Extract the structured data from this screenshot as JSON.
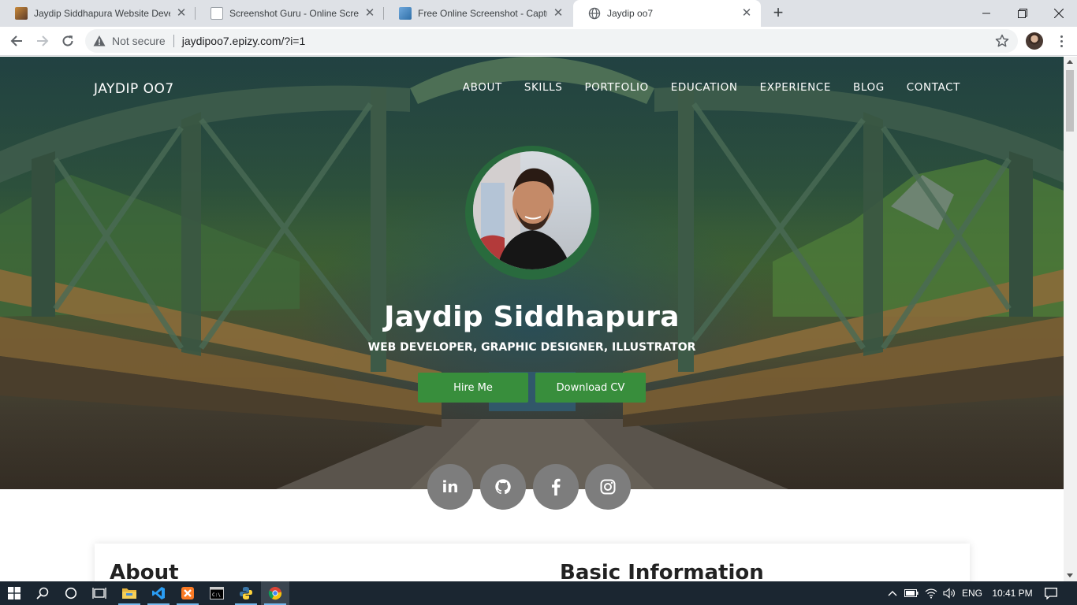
{
  "browser": {
    "tabs": [
      {
        "title": "Jaydip Siddhapura Website Deve",
        "favicon": "profile-photo-favicon",
        "active": false
      },
      {
        "title": "Screenshot Guru - Online Screen",
        "favicon": "document-favicon",
        "active": false
      },
      {
        "title": "Free Online Screenshot - Capture",
        "favicon": "image-favicon",
        "active": false
      },
      {
        "title": "Jaydip oo7",
        "favicon": "globe-favicon",
        "active": true
      }
    ],
    "new_tab_label": "+",
    "security_text": "Not secure",
    "url": "jaydipoo7.epizy.com/?i=1"
  },
  "site": {
    "brand": "JAYDIP OO7",
    "nav": [
      "ABOUT",
      "SKILLS",
      "PORTFOLIO",
      "EDUCATION",
      "EXPERIENCE",
      "BLOG",
      "CONTACT"
    ],
    "hero_name": "Jaydip Siddhapura",
    "hero_subtitle": "WEB DEVELOPER, GRAPHIC DESIGNER, ILLUSTRATOR",
    "buttons": {
      "hire": "Hire Me",
      "cv": "Download CV"
    },
    "social": [
      "linkedin-icon",
      "github-icon",
      "facebook-icon",
      "instagram-icon"
    ],
    "social_labels": {
      "linkedin": "in"
    },
    "sections": {
      "about": "About",
      "basic_info": "Basic Information"
    },
    "accent_color": "#388e3c"
  },
  "taskbar": {
    "apps": [
      "file-explorer",
      "vs-code",
      "xampp",
      "command-prompt",
      "python",
      "chrome"
    ],
    "language": "ENG",
    "time": "10:41 PM"
  }
}
